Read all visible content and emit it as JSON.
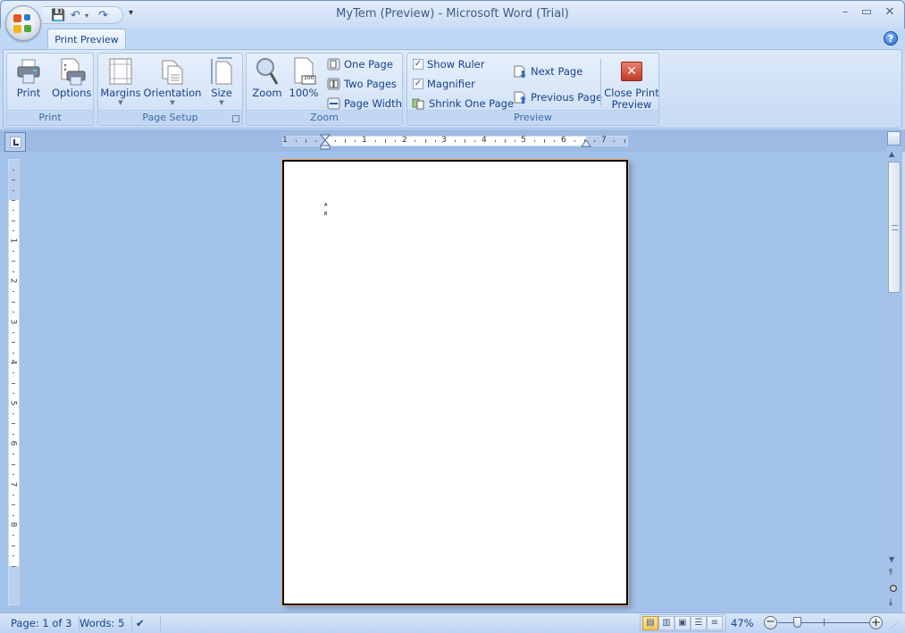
{
  "window": {
    "title": "MyTem (Preview) - Microsoft Word (Trial)",
    "controls": {
      "minimize": "–",
      "maximize": "▭",
      "close": "✕"
    }
  },
  "quick_access": {
    "save": "save-icon",
    "undo": "undo-icon",
    "redo": "redo-icon",
    "customize": "▾"
  },
  "tabs": [
    {
      "label": "Print Preview",
      "active": true
    }
  ],
  "help": "?",
  "ribbon": {
    "groups": {
      "print": {
        "label": "Print",
        "buttons": [
          {
            "label": "Print"
          },
          {
            "label": "Options"
          }
        ]
      },
      "page_setup": {
        "label": "Page Setup",
        "buttons": [
          {
            "label": "Margins"
          },
          {
            "label": "Orientation"
          },
          {
            "label": "Size"
          }
        ]
      },
      "zoom": {
        "label": "Zoom",
        "buttons": [
          {
            "label": "Zoom"
          },
          {
            "label": "100%"
          }
        ],
        "small_buttons": [
          {
            "label": "One Page"
          },
          {
            "label": "Two Pages"
          },
          {
            "label": "Page Width"
          }
        ],
        "icon_badge": "100"
      },
      "preview": {
        "label": "Preview",
        "checkboxes": [
          {
            "label": "Show Ruler",
            "checked": true
          },
          {
            "label": "Magnifier",
            "checked": true
          }
        ],
        "shrink": "Shrink One Page",
        "next": "Next Page",
        "previous": "Previous Page",
        "close_line1": "Close Print",
        "close_line2": "Preview"
      }
    }
  },
  "ruler": {
    "horizontal_labels": [
      "1",
      "1",
      "2",
      "3",
      "4",
      "5",
      "6",
      "7"
    ],
    "vertical_labels": [
      "1",
      "1",
      "2",
      "3",
      "4",
      "5",
      "6",
      "7",
      "8"
    ]
  },
  "document": {
    "page_text": [
      "A",
      "B"
    ]
  },
  "status": {
    "page": "Page: 1 of 3",
    "words": "Words: 5",
    "zoom": "47%",
    "zoom_level": 0.47
  }
}
